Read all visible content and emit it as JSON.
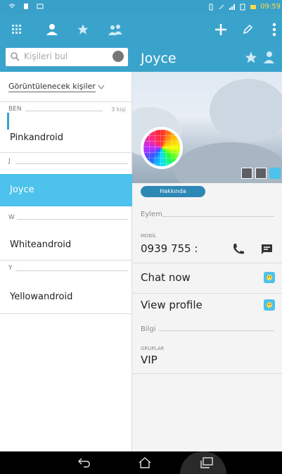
{
  "status": {
    "time": "09:59"
  },
  "search": {
    "placeholder": "Kişileri bul"
  },
  "filter": {
    "label": "Görüntülenecek kişiler"
  },
  "sections": [
    {
      "label": "BEN",
      "count": "3 kişi"
    },
    {
      "label": "J"
    },
    {
      "label": "W"
    },
    {
      "label": "Y"
    }
  ],
  "contacts": {
    "pinkandroid": "Pinkandroid",
    "joyce": "Joyce",
    "whiteandroid": "Whiteandroid",
    "yellowandroid": "Yellowandroid"
  },
  "detail": {
    "name": "Joyce",
    "about_button": "Hakkında",
    "actions_section": "Eylem",
    "mobile_label": "MOBİL",
    "phone": "0939 755 :",
    "chat_now": "Chat now",
    "view_profile": "View profile",
    "info_section": "Bilgi",
    "groups_label": "GRUPLAR",
    "group_value": "VIP"
  },
  "colors": {
    "accent": "#3aa3cc",
    "selected": "#4cc2ec"
  },
  "icons": {
    "tabs": [
      "grid-icon",
      "person-icon",
      "star-icon",
      "group-icon"
    ],
    "actions": [
      "plus-icon",
      "edit-icon",
      "more-icon"
    ],
    "nav": [
      "back-icon",
      "home-icon",
      "recents-icon"
    ]
  }
}
